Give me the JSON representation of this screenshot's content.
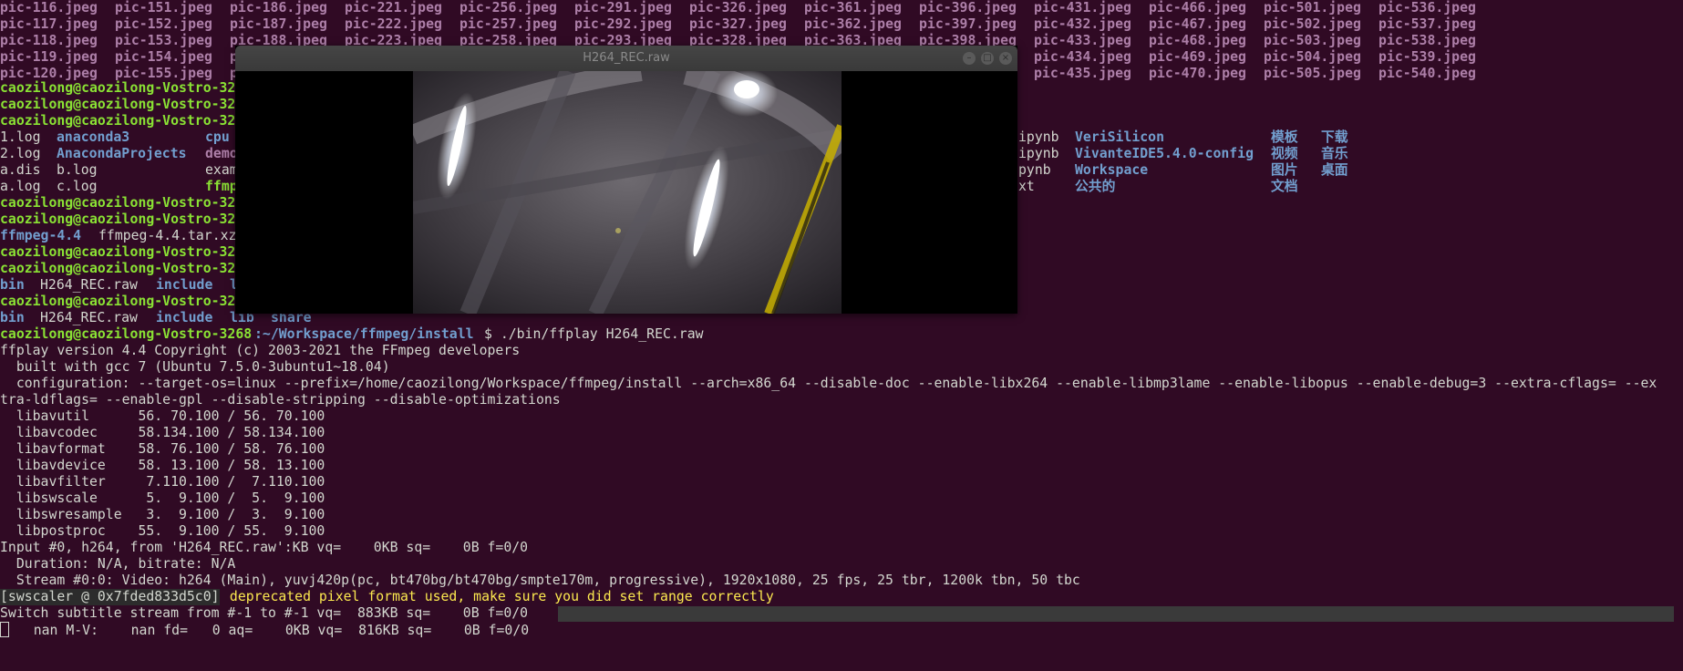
{
  "pic_grid": {
    "rows": [
      [
        "pic-116.jpeg",
        "pic-151.jpeg",
        "pic-186.jpeg",
        "pic-221.jpeg",
        "pic-256.jpeg",
        "pic-291.jpeg",
        "pic-326.jpeg",
        "pic-361.jpeg",
        "pic-396.jpeg",
        "pic-431.jpeg",
        "pic-466.jpeg",
        "pic-501.jpeg",
        "pic-536.jpeg"
      ],
      [
        "pic-117.jpeg",
        "pic-152.jpeg",
        "pic-187.jpeg",
        "pic-222.jpeg",
        "pic-257.jpeg",
        "pic-292.jpeg",
        "pic-327.jpeg",
        "pic-362.jpeg",
        "pic-397.jpeg",
        "pic-432.jpeg",
        "pic-467.jpeg",
        "pic-502.jpeg",
        "pic-537.jpeg"
      ],
      [
        "pic-118.jpeg",
        "pic-153.jpeg",
        "pic-188.jpeg",
        "pic-223.jpeg",
        "pic-258.jpeg",
        "pic-293.jpeg",
        "pic-328.jpeg",
        "pic-363.jpeg",
        "pic-398.jpeg",
        "pic-433.jpeg",
        "pic-468.jpeg",
        "pic-503.jpeg",
        "pic-538.jpeg"
      ],
      [
        "pic-119.jpeg",
        "pic-154.jpeg",
        "p",
        "",
        "",
        "",
        "",
        "",
        "",
        "pic-434.jpeg",
        "pic-469.jpeg",
        "pic-504.jpeg",
        "pic-539.jpeg"
      ],
      [
        "pic-120.jpeg",
        "pic-155.jpeg",
        "p",
        "",
        "",
        "",
        "",
        "",
        "",
        "pic-435.jpeg",
        "pic-470.jpeg",
        "pic-505.jpeg",
        "pic-540.jpeg"
      ]
    ]
  },
  "prompt_user_truncated": "caozilong@caozilong-Vostro-32",
  "ls_home": {
    "col1": [
      "1.log",
      "2.log",
      "a.dis",
      "a.log"
    ],
    "col2": [
      "anaconda3",
      "AnacondaProjects",
      "b.log",
      "c.log"
    ],
    "col3": [
      "cpu",
      "demo",
      "exam",
      "ffmp"
    ],
    "right_col1": [
      "ipynb",
      "ipynb",
      "pynb",
      "xt"
    ],
    "right_col2": [
      "VeriSilicon",
      "VivanteIDE5.4.0-config",
      "Workspace",
      "公共的"
    ],
    "right_col3": [
      "模板",
      "视频",
      "图片",
      "文档"
    ],
    "right_col4": [
      "下载",
      "音乐",
      "桌面",
      ""
    ]
  },
  "ls_ffmpeg": {
    "item1": "ffmpeg-4.4",
    "item2": "ffmpeg-4.4.tar.xz"
  },
  "ls_install_trunc": {
    "bin": "bin",
    "raw": "H264_REC.raw",
    "include": "include",
    "l": "l"
  },
  "ls_install": {
    "bin": "bin",
    "raw": "H264_REC.raw",
    "include": "include",
    "lib": "lib",
    "share": "share"
  },
  "cmd": {
    "user": "caozilong@caozilong-Vostro-3268",
    "path": ":~/Workspace/ffmpeg/install",
    "text": "$ ./bin/ffplay H264_REC.raw"
  },
  "output_lines": [
    "ffplay version 4.4 Copyright (c) 2003-2021 the FFmpeg developers",
    "  built with gcc 7 (Ubuntu 7.5.0-3ubuntu1~18.04)",
    "  configuration: --target-os=linux --prefix=/home/caozilong/Workspace/ffmpeg/install --arch=x86_64 --disable-doc --enable-libx264 --enable-libmp3lame --enable-libopus --enable-debug=3 --extra-cflags= --ex",
    "tra-ldflags= --enable-gpl --disable-stripping --disable-optimizations",
    "  libavutil      56. 70.100 / 56. 70.100",
    "  libavcodec     58.134.100 / 58.134.100",
    "  libavformat    58. 76.100 / 58. 76.100",
    "  libavdevice    58. 13.100 / 58. 13.100",
    "  libavfilter     7.110.100 /  7.110.100",
    "  libswscale      5.  9.100 /  5.  9.100",
    "  libswresample   3.  9.100 /  3.  9.100",
    "  libpostproc    55.  9.100 / 55.  9.100",
    "Input #0, h264, from 'H264_REC.raw':KB vq=    0KB sq=    0B f=0/0",
    "  Duration: N/A, bitrate: N/A",
    "  Stream #0:0: Video: h264 (Main), yuvj420p(pc, bt470bg/bt470bg/smpte170m, progressive), 1920x1080, 25 fps, 25 tbr, 1200k tbn, 50 tbc"
  ],
  "swscaler": {
    "tag": "[swscaler @ 0x7fded833d5c0]",
    "msg": " deprecated pixel format used, make sure you did set range correctly"
  },
  "status_line1": "Switch subtitle stream from #-1 to #-1 vq=  883KB sq=    0B f=0/0",
  "status_line2": "   nan M-V:    nan fd=   0 aq=    0KB vq=  816KB sq=    0B f=0/0",
  "player": {
    "title": "H264_REC.raw",
    "buttons": {
      "minimize": "–",
      "maximize": "□",
      "close": "×"
    }
  },
  "colors": {
    "terminal_bg": "#300a24",
    "text": "#d3d7cf",
    "directory": "#729fcf",
    "executable": "#8ae234",
    "image_file": "#ad7fa8",
    "warning": "#fce94f"
  }
}
